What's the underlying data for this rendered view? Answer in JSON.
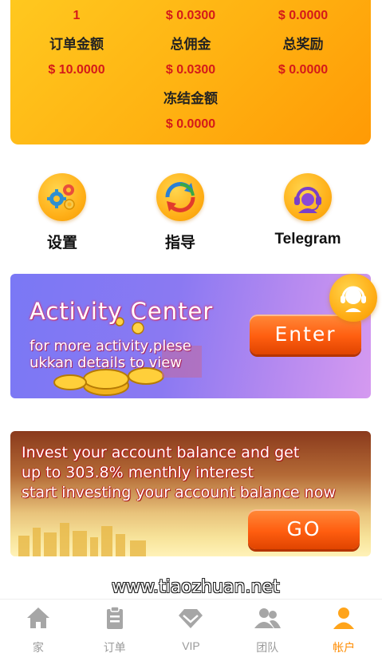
{
  "stats": {
    "row1": [
      {
        "value": "1"
      },
      {
        "value": "$  0.0300"
      },
      {
        "value": "$ 0.0000"
      }
    ],
    "row2": [
      {
        "label": "订单金额",
        "value": "$ 10.0000"
      },
      {
        "label": "总佣金",
        "value": "$ 0.0300"
      },
      {
        "label": "总奖励",
        "value": "$ 0.0000"
      }
    ],
    "row3": [
      {
        "label": "冻结金额",
        "value": "$ 0.0000"
      }
    ]
  },
  "actions": [
    {
      "label": "设置",
      "icon": "gears-icon"
    },
    {
      "label": "指导",
      "icon": "refresh-arrows-icon"
    },
    {
      "label": "Telegram",
      "icon": "headset-support-icon"
    }
  ],
  "activity_banner": {
    "title": "Activity  Center",
    "subtitle": "for more activity,plese ukkan details to view",
    "button": "Enter"
  },
  "invest_banner": {
    "line1": "Invest your account balance and get",
    "line2": "up to 303.8% menthly interest",
    "line3": "start investing your account balance now",
    "button": "GO"
  },
  "watermark": "www.tiaozhuan.net",
  "nav": [
    {
      "label": "家",
      "icon": "home-icon"
    },
    {
      "label": "订单",
      "icon": "clipboard-icon"
    },
    {
      "label": "VIP",
      "icon": "diamond-icon"
    },
    {
      "label": "团队",
      "icon": "team-icon"
    },
    {
      "label": "帐户",
      "icon": "user-icon",
      "active": true
    }
  ],
  "colors": {
    "accent": "#ff9a05",
    "value_red": "#d41a1a",
    "nav_active": "#ff8c00",
    "nav_inactive": "#9a9a9a"
  }
}
